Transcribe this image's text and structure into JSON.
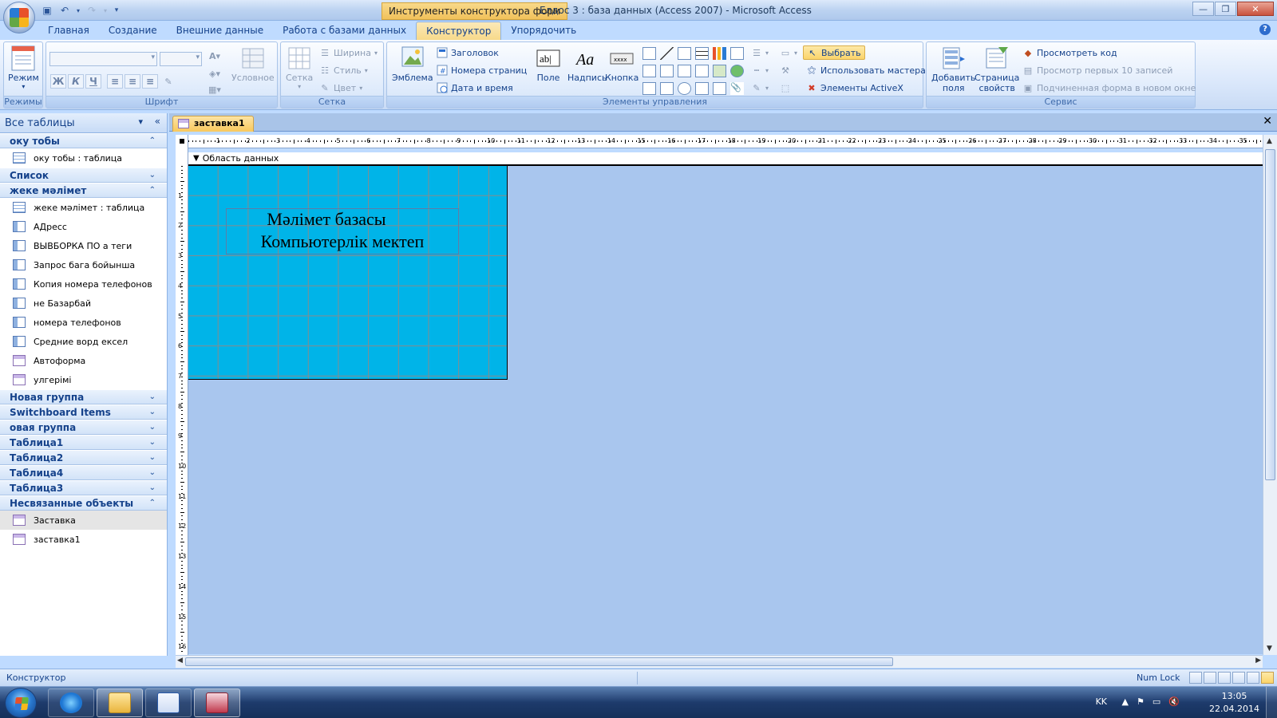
{
  "window": {
    "context_tab_title": "Инструменты конструктора форм",
    "app_title": "Елдос 3 : база данных (Access 2007) - Microsoft Access"
  },
  "ribbon_tabs": [
    {
      "label": "Главная"
    },
    {
      "label": "Создание"
    },
    {
      "label": "Внешние данные"
    },
    {
      "label": "Работа с базами данных"
    },
    {
      "label": "Конструктор"
    },
    {
      "label": "Упорядочить"
    }
  ],
  "ribbon": {
    "views": {
      "mode_label": "Режим",
      "group_label": "Режимы"
    },
    "font": {
      "conditional_label": "Условное",
      "group_label": "Шрифт",
      "bold": "Ж",
      "italic": "К",
      "underline": "Ч"
    },
    "grid": {
      "grid_label": "Сетка",
      "width_label": "Ширина",
      "style_label": "Стиль",
      "color_label": "Цвет",
      "group_label": "Сетка"
    },
    "controls": {
      "logo_label": "Эмблема",
      "title_label": "Заголовок",
      "page_numbers_label": "Номера страниц",
      "date_time_label": "Дата и время",
      "field_label": "Поле",
      "field_icon_text": "ab|",
      "label_label": "Надпись",
      "label_icon_text": "Aa",
      "button_label": "Кнопка",
      "button_icon_text": "xxxx",
      "select_label": "Выбрать",
      "use_wizards_label": "Использовать мастера",
      "activex_label": "Элементы ActiveX",
      "group_label": "Элементы управления"
    },
    "tools": {
      "add_fields_label_1": "Добавить",
      "add_fields_label_2": "поля",
      "property_sheet_label_1": "Страница",
      "property_sheet_label_2": "свойств",
      "view_code_label": "Просмотреть код",
      "top10_label": "Просмотр первых 10 записей",
      "subform_label": "Подчиненная форма в новом окне",
      "group_label": "Сервис"
    }
  },
  "nav": {
    "header": "Все таблицы",
    "groups": [
      {
        "label": "оку тобы",
        "expanded": true,
        "items": [
          {
            "label": "оку тобы : таблица",
            "type": "table"
          }
        ]
      },
      {
        "label": "Список",
        "expanded": false,
        "items": []
      },
      {
        "label": "жеке мәлімет",
        "expanded": true,
        "items": [
          {
            "label": "жеке мәлімет : таблица",
            "type": "table"
          },
          {
            "label": "АДресс",
            "type": "query"
          },
          {
            "label": "ВЫВБОРКА  ПО а теги",
            "type": "query"
          },
          {
            "label": "Запрос бага бойынша",
            "type": "query"
          },
          {
            "label": "Копия номера телефонов",
            "type": "query"
          },
          {
            "label": "не Базарбай",
            "type": "query"
          },
          {
            "label": "номера телефонов",
            "type": "query"
          },
          {
            "label": "Средние ворд ексел",
            "type": "query"
          },
          {
            "label": "Автоформа",
            "type": "form"
          },
          {
            "label": "улгерімі",
            "type": "form"
          }
        ]
      },
      {
        "label": "Новая группа",
        "expanded": false,
        "items": []
      },
      {
        "label": "Switchboard Items",
        "expanded": false,
        "items": []
      },
      {
        "label": "овая группа",
        "expanded": false,
        "items": []
      },
      {
        "label": "Таблица1",
        "expanded": false,
        "items": []
      },
      {
        "label": "Таблица2",
        "expanded": false,
        "items": []
      },
      {
        "label": "Таблица4",
        "expanded": false,
        "items": []
      },
      {
        "label": "Таблица3",
        "expanded": false,
        "items": []
      },
      {
        "label": "Несвязанные объекты",
        "expanded": true,
        "items": [
          {
            "label": "Заставка",
            "type": "form",
            "selected": true
          },
          {
            "label": "заставка1",
            "type": "form"
          }
        ]
      }
    ]
  },
  "document": {
    "tab_label": "заставка1",
    "section_label": "Область данных",
    "label_line1": "Мәлімет базасы",
    "label_line2": "Компьютерлік мектеп",
    "detail_color": "#00b4e8"
  },
  "statusbar": {
    "mode": "Конструктор",
    "numlock": "Num Lock"
  },
  "taskbar": {
    "language": "KK",
    "time": "13:05",
    "date": "22.04.2014"
  }
}
